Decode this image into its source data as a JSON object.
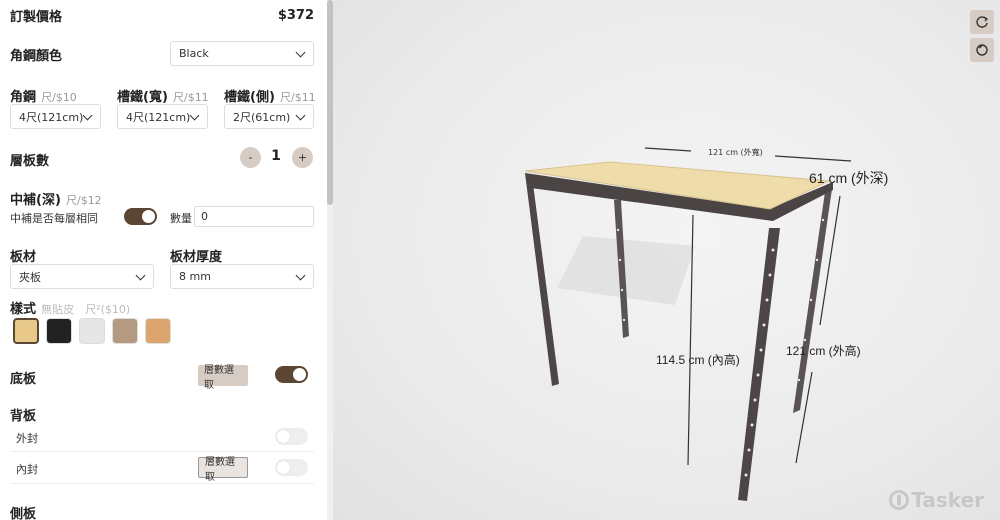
{
  "price": {
    "label": "訂製價格",
    "value": "$372"
  },
  "frame_color": {
    "label": "角鋼顏色",
    "value": "Black"
  },
  "angle_steel": {
    "label": "角鋼",
    "unit_price": "尺/$10",
    "value": "4尺(121cm)"
  },
  "channel_width": {
    "label": "槽鐵(寬)",
    "unit_price": "尺/$11",
    "value": "4尺(121cm)"
  },
  "channel_side": {
    "label": "槽鐵(側)",
    "unit_price": "尺/$11",
    "value": "2尺(61cm)"
  },
  "shelf_count": {
    "label": "層板數",
    "minus": "-",
    "value": "1",
    "plus": "+"
  },
  "mid_support": {
    "label": "中補(深)",
    "unit_price": "尺/$12",
    "same_label": "中補是否每層相同",
    "same_on": true,
    "qty_label": "數量",
    "qty_value": "0"
  },
  "board": {
    "label": "板材",
    "value": "夾板"
  },
  "thickness": {
    "label": "板材厚度",
    "value": "8 mm"
  },
  "style": {
    "label": "樣式",
    "note1": "無貼皮",
    "note2": "尺²($10)",
    "swatches": [
      {
        "name": "light-wood",
        "color": "#e8c98a",
        "selected": true
      },
      {
        "name": "black",
        "color": "#222222",
        "selected": false
      },
      {
        "name": "white",
        "color": "#e6e6e6",
        "selected": false
      },
      {
        "name": "grey-wood",
        "color": "#b59a82",
        "selected": false
      },
      {
        "name": "oak",
        "color": "#dca56d",
        "selected": false
      }
    ]
  },
  "bottom_board": {
    "label": "底板",
    "btn": "層數選取",
    "on": true
  },
  "back_board": {
    "label": "背板",
    "outer_label": "外封",
    "outer_on": false,
    "inner_label": "內封",
    "inner_btn": "層數選取",
    "inner_on": false
  },
  "side_board": {
    "label": "側板"
  },
  "viewer": {
    "dim_width": "121 cm (外寬)",
    "dim_depth": "61 cm (外深)",
    "dim_inner_height": "114.5 cm (內高)",
    "dim_outer_height": "121 cm (外高)",
    "watermark": "Tasker",
    "rotate_icon": "rotate-icon",
    "reset_icon": "reset-icon"
  },
  "colors": {
    "accent": "#5b4634",
    "button": "#d6ccc4"
  }
}
